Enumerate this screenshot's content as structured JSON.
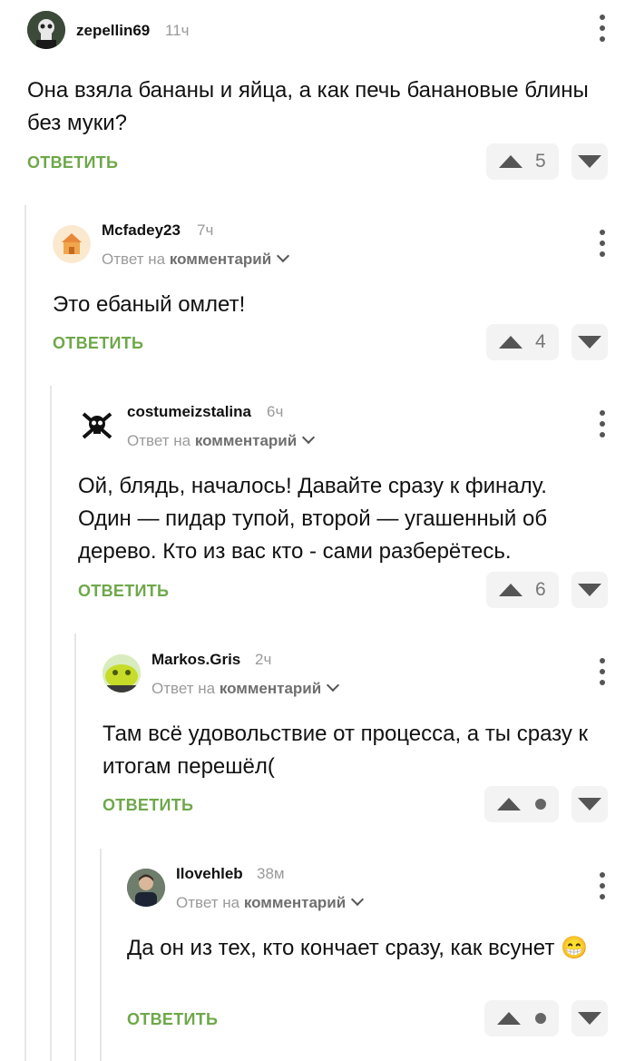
{
  "reply_label": "ОТВЕТИТЬ",
  "reply_to_prefix": "Ответ на",
  "reply_to_link": "комментарий",
  "comments": [
    {
      "author": "zepellin69",
      "time": "11ч",
      "text": "Она взяла бананы и яйца, а как печь банановые блины без муки?",
      "rating": "5",
      "avatar": "punisher-skull-avatar"
    },
    {
      "author": "Mcfadey23",
      "time": "7ч",
      "text": "Это ебаный омлет!",
      "rating": "4",
      "avatar": "cartoon-house-avatar"
    },
    {
      "author": "costumeizstalina",
      "time": "6ч",
      "text": "Ой, блядь, началось! Давайте сразу к финалу. Один — пидар тупой, второй — угашенный об дерево. Кто из вас кто - сами разберётесь.",
      "rating": "6",
      "avatar": "skull-crossbones-avatar"
    },
    {
      "author": "Markos.Gris",
      "time": "2ч",
      "text": "Там всё удовольствие от процесса, а ты сразу к итогам перешёл(",
      "rating": "",
      "avatar": "green-face-avatar"
    },
    {
      "author": "Ilovehleb",
      "time": "38м",
      "text": "Да он из тех, кто кончает сразу, как всунет 😁",
      "rating": "",
      "avatar": "person-photo-avatar"
    }
  ]
}
